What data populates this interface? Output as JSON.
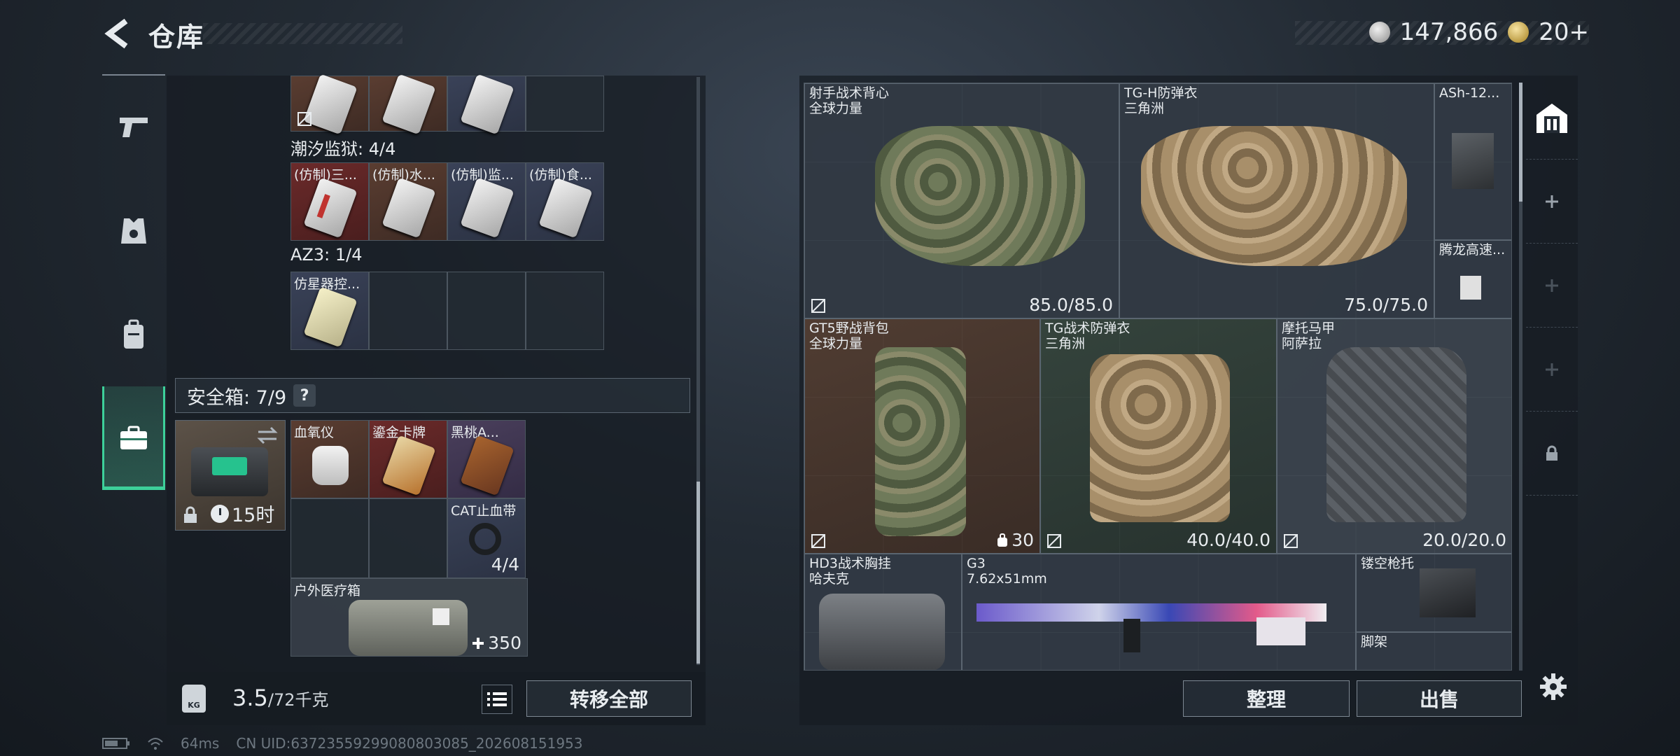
{
  "header": {
    "title": "仓库",
    "currency_silver": "147,866",
    "currency_gold": "20+"
  },
  "left_nav": {
    "items": [
      {
        "icon": "pistol-icon"
      },
      {
        "icon": "helmet-vest-icon"
      },
      {
        "icon": "backpack-icon"
      },
      {
        "icon": "briefcase-icon",
        "active": true
      }
    ]
  },
  "middle": {
    "section1": "潮汐监狱: 4/4",
    "section1_items": [
      "(仿制)三...",
      "(仿制)水...",
      "(仿制)监...",
      "(仿制)食..."
    ],
    "section2": "AZ3: 1/4",
    "section2_items": [
      "仿星器控..."
    ],
    "safebox": {
      "label": "安全箱: 7/9",
      "help": "?",
      "timer": "15时"
    },
    "safebox_items": {
      "item1": "血氧仪",
      "item2": "鎏金卡牌",
      "item3": "黑桃A...",
      "item4": "CAT止血带",
      "item4_count": "4/4",
      "item5": "户外医疗箱",
      "item5_count": "350"
    },
    "weight_value": "3.5",
    "weight_max": "/72千克",
    "kg_label": "KG",
    "transfer_all": "转移全部"
  },
  "right": {
    "items": [
      {
        "name": "射手战术背心",
        "sub": "全球力量",
        "durability": "85.0/85.0"
      },
      {
        "name": "TG-H防弹衣",
        "sub": "三角洲",
        "durability": "75.0/75.0"
      },
      {
        "name": "ASh-12...",
        "sub": ""
      },
      {
        "name": "腾龙高速...",
        "sub": ""
      },
      {
        "name": "GT5野战背包",
        "sub": "全球力量",
        "capacity": "30"
      },
      {
        "name": "TG战术防弹衣",
        "sub": "三角洲",
        "durability": "40.0/40.0"
      },
      {
        "name": "摩托马甲",
        "sub": "阿萨拉",
        "durability": "20.0/20.0"
      },
      {
        "name": "HD3战术胸挂",
        "sub": "哈夫克"
      },
      {
        "name": "G3",
        "sub": "7.62x51mm"
      },
      {
        "name": "镂空枪托",
        "sub": ""
      },
      {
        "name": "脚架",
        "sub": ""
      }
    ],
    "sort_button": "整理",
    "sell_button": "出售"
  },
  "status": {
    "ping": "64ms",
    "uid": "CN UID:63723559299080803085_202608151953"
  },
  "colors": {
    "accent": "#3dd09a",
    "panel": "#1c232b"
  }
}
